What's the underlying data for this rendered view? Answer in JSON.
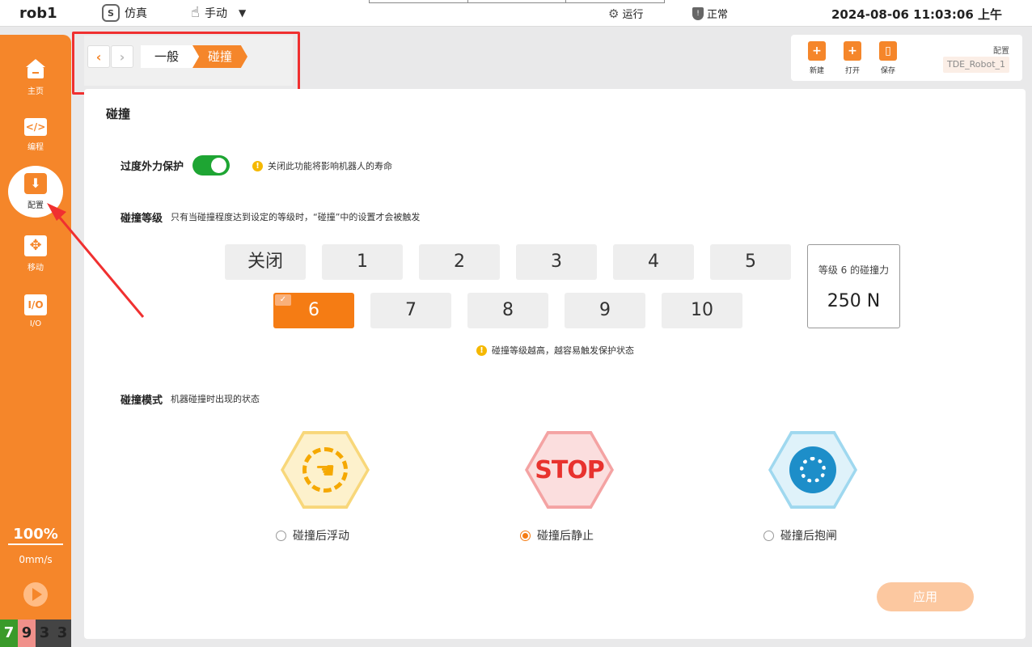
{
  "topbar": {
    "robot_name": "rob1",
    "sim_mode": "仿真",
    "sim_icon": "S",
    "manual_mode": "手动",
    "run_status": "运行",
    "normal_status": "正常",
    "datetime": "2024-08-06 11:03:06 上午"
  },
  "sidebar": {
    "items": [
      {
        "label": "主页",
        "icon": "home-icon"
      },
      {
        "label": "编程",
        "icon": "code-icon",
        "glyph": "</>"
      },
      {
        "label": "配置",
        "icon": "config-icon",
        "glyph": "⬇"
      },
      {
        "label": "移动",
        "icon": "move-icon",
        "glyph": "✥"
      },
      {
        "label": "I/O",
        "icon": "io-icon",
        "glyph": "I/O"
      }
    ],
    "speed_percent": "100%",
    "speed_value": "0mm/s",
    "counters": [
      {
        "value": "7",
        "color": "#3a9a2a",
        "text": "#ffffff"
      },
      {
        "value": "9",
        "color": "#f0908a",
        "text": "#222222"
      },
      {
        "value": "3",
        "color": "#444444",
        "text": "#222222"
      },
      {
        "value": "3",
        "color": "#444444",
        "text": "#222222"
      }
    ]
  },
  "breadcrumb": {
    "general": "一般",
    "collision": "碰撞"
  },
  "toolbar": {
    "new_label": "新建",
    "open_label": "打开",
    "save_label": "保存",
    "config_label": "配置",
    "config_value": "TDE_Robot_1"
  },
  "main": {
    "title": "碰撞",
    "protect_label": "过度外力保护",
    "protect_warning": "关闭此功能将影响机器人的寿命",
    "level_label": "碰撞等级",
    "level_desc": "只有当碰撞程度达到设定的等级时，“碰撞”中的设置才会被触发",
    "levels": [
      "关闭",
      "1",
      "2",
      "3",
      "4",
      "5",
      "6",
      "7",
      "8",
      "9",
      "10"
    ],
    "selected_level": "6",
    "force_label": "等级 6 的碰撞力",
    "force_value": "250 N",
    "level_warning": "碰撞等级越高，越容易触发保护状态",
    "mode_label": "碰撞模式",
    "mode_desc": "机器碰撞时出现的状态",
    "modes": [
      {
        "label": "碰撞后浮动",
        "icon": "float-hand-icon",
        "selected": false
      },
      {
        "label": "碰撞后静止",
        "icon": "stop-sign-icon",
        "glyph": "STOP",
        "selected": true
      },
      {
        "label": "碰撞后抱闸",
        "icon": "brake-disc-icon",
        "selected": false
      }
    ],
    "apply_label": "应用"
  },
  "colors": {
    "accent": "#f57c14",
    "toggle_on": "#1ea533",
    "warning": "#f5b800",
    "annotation": "#f03030"
  }
}
